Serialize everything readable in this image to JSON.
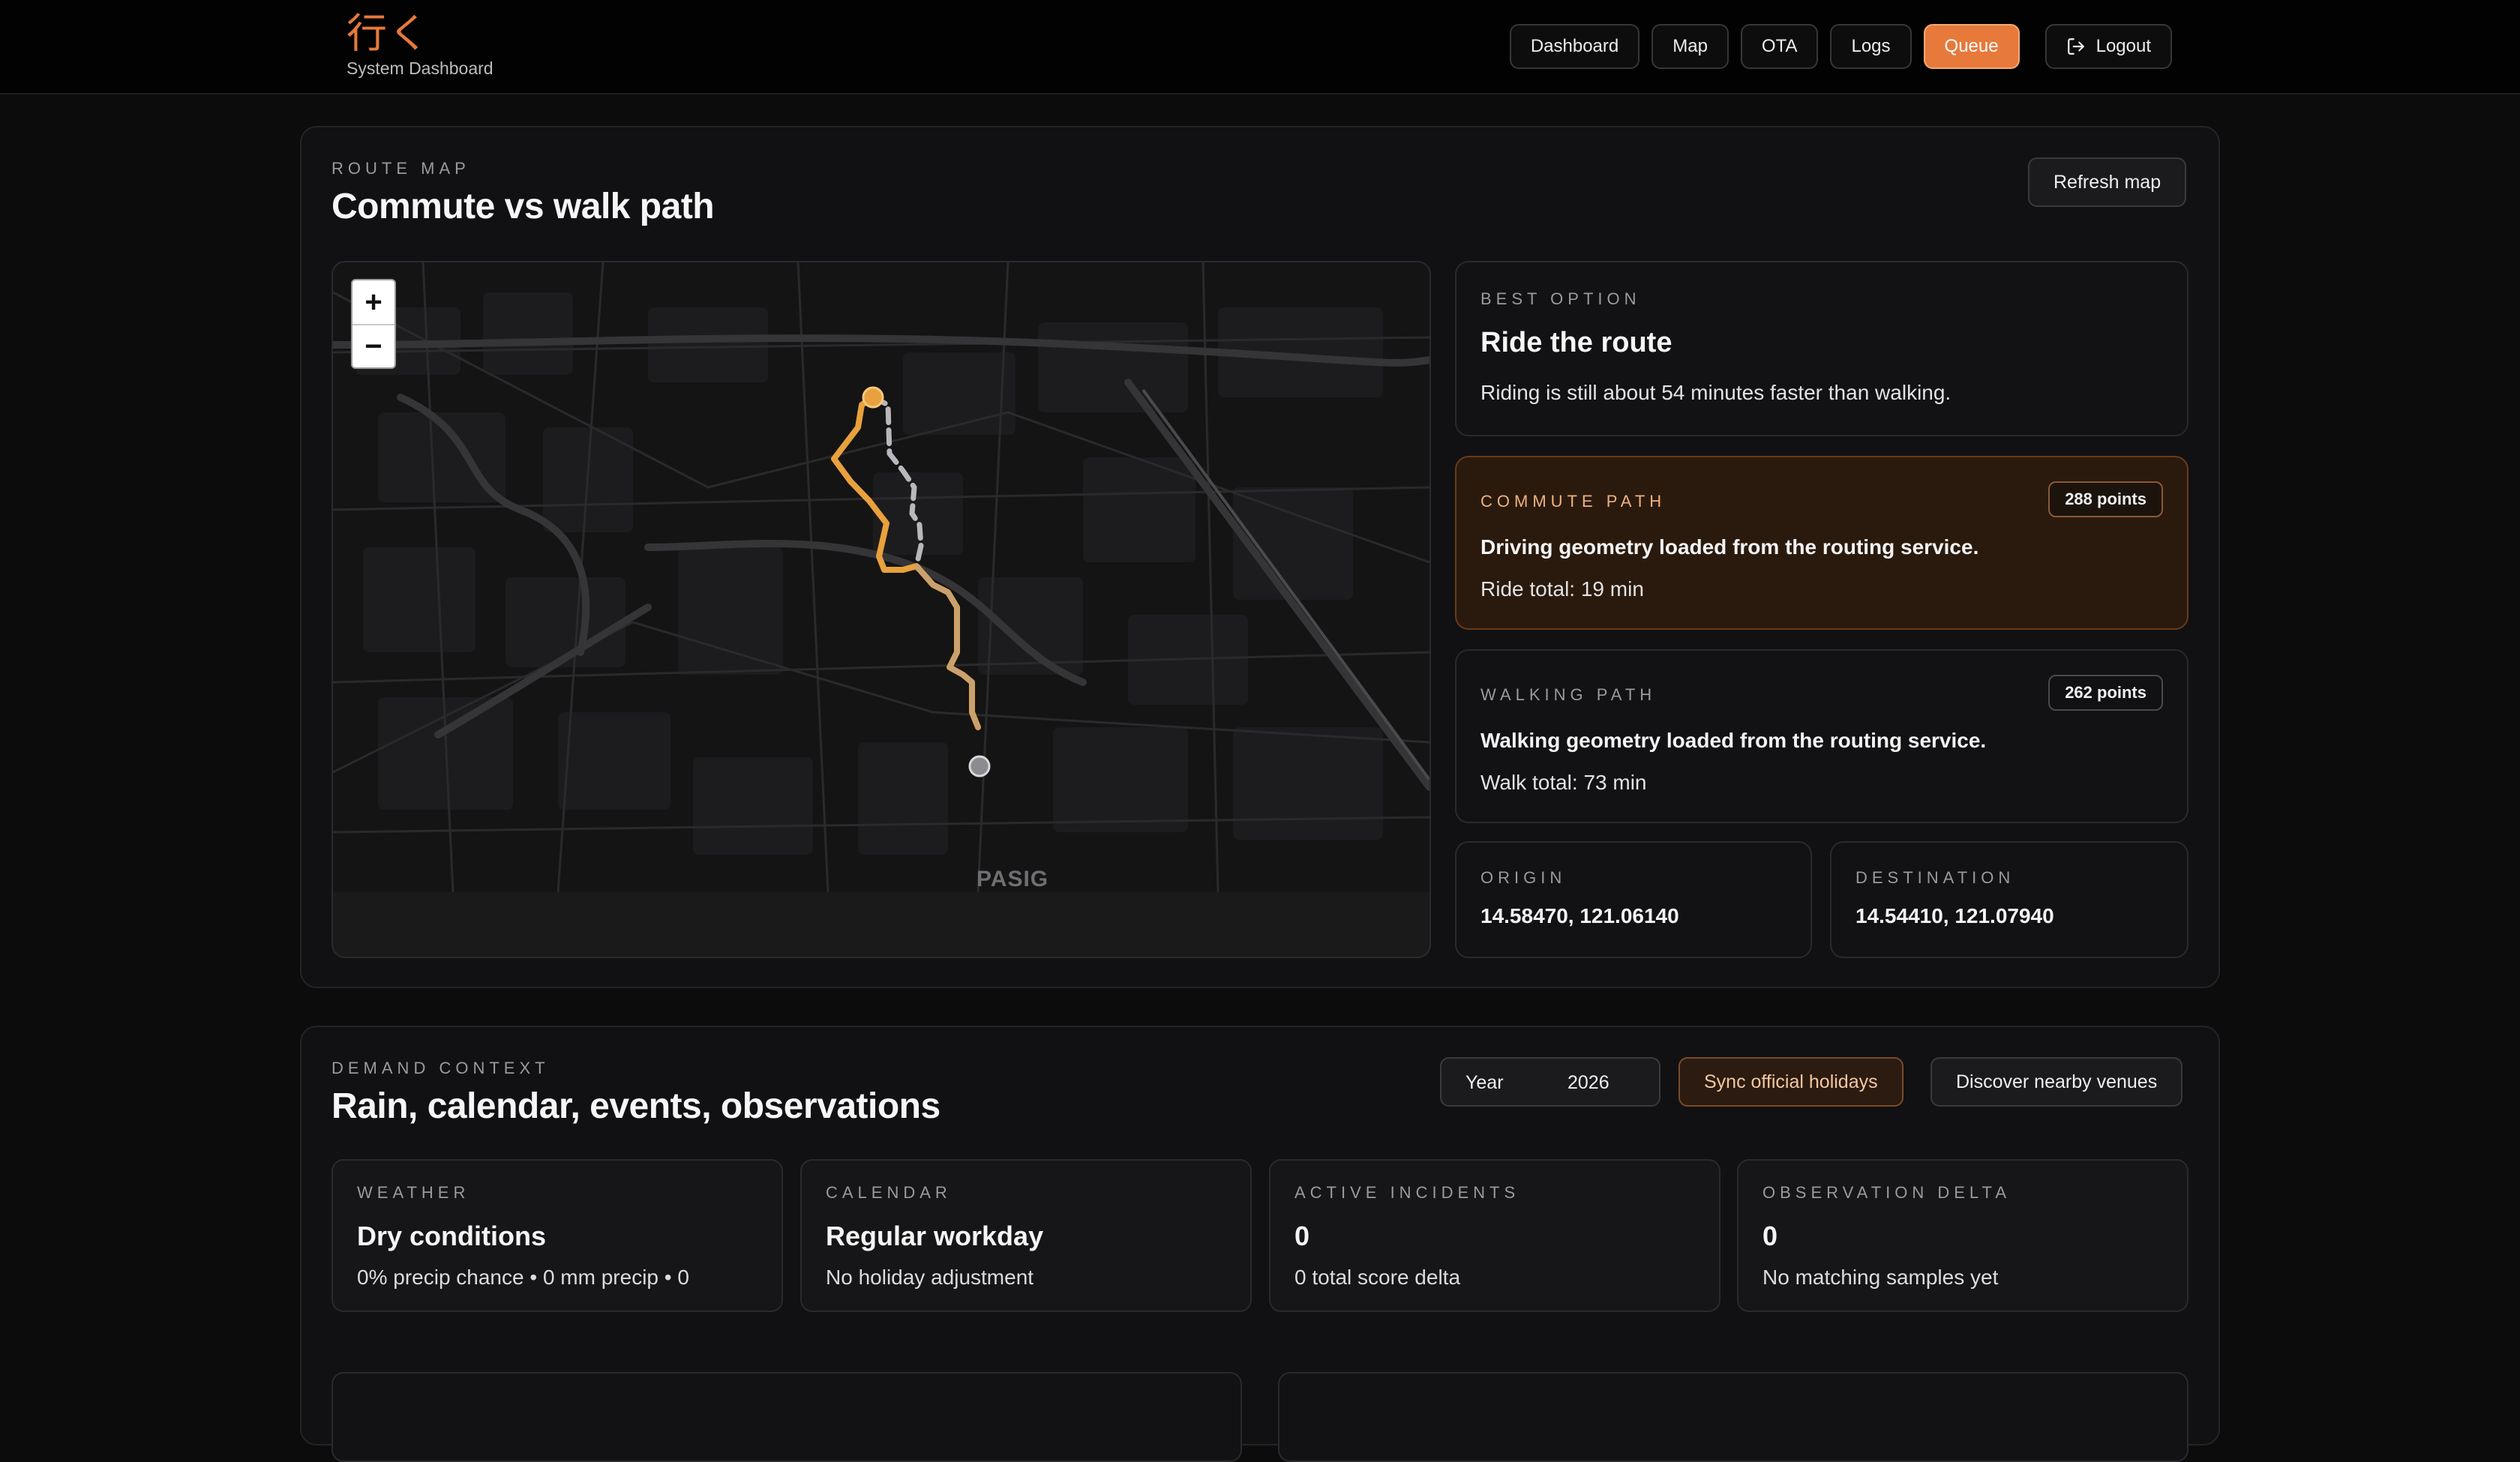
{
  "brand": {
    "logo": "行く",
    "subtitle": "System Dashboard"
  },
  "nav": {
    "items": [
      "Dashboard",
      "Map",
      "OTA",
      "Logs",
      "Queue"
    ],
    "active": "Queue",
    "logout": "Logout"
  },
  "route_map": {
    "eyebrow": "ROUTE MAP",
    "title": "Commute vs walk path",
    "refresh": "Refresh map",
    "map_label": "PASIG",
    "zoom_in": "+",
    "zoom_out": "−",
    "best": {
      "eyebrow": "BEST OPTION",
      "title": "Ride the route",
      "text": "Riding is still about 54 minutes faster than walking."
    },
    "commute": {
      "eyebrow": "COMMUTE PATH",
      "badge": "288 points",
      "text": "Driving geometry loaded from the routing service.",
      "total": "Ride total: 19 min"
    },
    "walking": {
      "eyebrow": "WALKING PATH",
      "badge": "262 points",
      "text": "Walking geometry loaded from the routing service.",
      "total": "Walk total: 73 min"
    },
    "origin": {
      "eyebrow": "ORIGIN",
      "value": "14.58470, 121.06140"
    },
    "destination": {
      "eyebrow": "DESTINATION",
      "value": "14.54410, 121.07940"
    },
    "colors": {
      "commute": "#e8a13c",
      "walk": "#9a9a9e",
      "accent": "#e7793b"
    }
  },
  "demand": {
    "eyebrow": "DEMAND CONTEXT",
    "title": "Rain, calendar, events, observations",
    "year_label": "Year",
    "year_value": "2026",
    "sync": "Sync official holidays",
    "discover": "Discover nearby venues",
    "stats": [
      {
        "eyebrow": "WEATHER",
        "value": "Dry conditions",
        "sub": "0% precip chance • 0 mm precip • 0"
      },
      {
        "eyebrow": "CALENDAR",
        "value": "Regular workday",
        "sub": "No holiday adjustment"
      },
      {
        "eyebrow": "ACTIVE INCIDENTS",
        "value": "0",
        "sub": "0 total score delta"
      },
      {
        "eyebrow": "OBSERVATION DELTA",
        "value": "0",
        "sub": "No matching samples yet"
      }
    ]
  }
}
